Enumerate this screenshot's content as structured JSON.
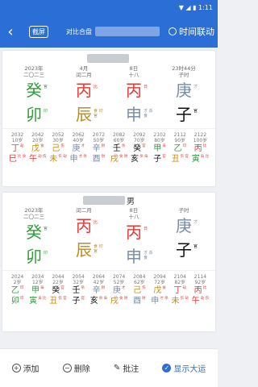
{
  "status": {
    "time": "",
    "icons": "▼ ◢ ▮ 1:11"
  },
  "header": {
    "back_icon": "chevron-left-icon",
    "cut_label": "截屏",
    "title": "对比合盘",
    "link_label": "时间联动"
  },
  "cards": [
    {
      "gender": "",
      "pillars": [
        {
          "top1": "2023年",
          "top2": "二〇二三",
          "gan": "癸",
          "gan_tag": "官",
          "gan_color": "green",
          "zhi": "卯",
          "zhi_tag": "印",
          "zhi_color": "green"
        },
        {
          "top1": "4月",
          "top2": "闰二月",
          "gan": "丙",
          "gan_tag": "比",
          "gan_color": "red",
          "zhi": "辰",
          "zhi_tag": "食 印 官",
          "zhi_color": "gold"
        },
        {
          "top1": "8日",
          "top2": "十八",
          "gan": "丙",
          "gan_tag": "日",
          "gan_color": "red",
          "zhi": "申",
          "zhi_tag": "才 杀 食",
          "zhi_color": "gray"
        },
        {
          "top1": "23时44分",
          "top2": "子时",
          "gan": "庚",
          "gan_tag": "才",
          "gan_color": "gray",
          "zhi": "子",
          "zhi_tag": "官",
          "zhi_color": "black"
        }
      ],
      "luck": [
        {
          "yr": "2032",
          "age": "10岁",
          "g": "丁",
          "gc": "red",
          "gt": "劫",
          "z": "巳",
          "zc": "red",
          "zt": "比 食"
        },
        {
          "yr": "2042",
          "age": "20岁",
          "g": "戊",
          "gc": "gold",
          "gt": "食",
          "z": "午",
          "zc": "red",
          "zt": "劫 伤"
        },
        {
          "yr": "2052",
          "age": "30岁",
          "g": "己",
          "gc": "gold",
          "gt": "伤",
          "z": "未",
          "zc": "gold",
          "zt": "伤 劫"
        },
        {
          "yr": "2062",
          "age": "40岁",
          "g": "庚",
          "gc": "gray",
          "gt": "才",
          "z": "申",
          "zc": "gray",
          "zt": "才 杀"
        },
        {
          "yr": "2072",
          "age": "50岁",
          "g": "辛",
          "gc": "gray",
          "gt": "财",
          "z": "酉",
          "zc": "gray",
          "zt": "财"
        },
        {
          "yr": "2082",
          "age": "60岁",
          "g": "壬",
          "gc": "black",
          "gt": "杀",
          "z": "戌",
          "zc": "gold",
          "zt": "食 财"
        },
        {
          "yr": "2092",
          "age": "70岁",
          "g": "癸",
          "gc": "black",
          "gt": "官",
          "z": "亥",
          "zc": "black",
          "zt": "杀 枭"
        },
        {
          "yr": "2102",
          "age": "80岁",
          "g": "甲",
          "gc": "green",
          "gt": "枭",
          "z": "子",
          "zc": "black",
          "zt": "官"
        },
        {
          "yr": "2112",
          "age": "90岁",
          "g": "乙",
          "gc": "green",
          "gt": "印",
          "z": "丑",
          "zc": "gold",
          "zt": "伤 官"
        },
        {
          "yr": "2122",
          "age": "100岁",
          "g": "丙",
          "gc": "red",
          "gt": "比",
          "z": "寅",
          "zc": "green",
          "zt": "枭 比"
        }
      ]
    },
    {
      "gender": "男",
      "pillars": [
        {
          "top1": "2023年",
          "top2": "二〇二三",
          "gan": "癸",
          "gan_tag": "官",
          "gan_color": "green",
          "zhi": "卯",
          "zhi_tag": "印",
          "zhi_color": "green"
        },
        {
          "top1": "",
          "top2": "闰二月",
          "gan": "丙",
          "gan_tag": "比",
          "gan_color": "red",
          "zhi": "辰",
          "zhi_tag": "食 印 官",
          "zhi_color": "gold"
        },
        {
          "top1": "8日",
          "top2": "十八",
          "gan": "丙",
          "gan_tag": "日",
          "gan_color": "red",
          "zhi": "申",
          "zhi_tag": "才 杀 食",
          "zhi_color": "gray"
        },
        {
          "top1": "",
          "top2": "子时",
          "gan": "庚",
          "gan_tag": "才",
          "gan_color": "gray",
          "zhi": "子",
          "zhi_tag": "官",
          "zhi_color": "black"
        }
      ],
      "luck": [
        {
          "yr": "2024",
          "age": "2岁",
          "g": "乙",
          "gc": "green",
          "gt": "印",
          "z": "卯",
          "zc": "green",
          "zt": "印"
        },
        {
          "yr": "2034",
          "age": "12岁",
          "g": "甲",
          "gc": "green",
          "gt": "枭",
          "z": "寅",
          "zc": "green",
          "zt": "枭 比"
        },
        {
          "yr": "2044",
          "age": "22岁",
          "g": "癸",
          "gc": "black",
          "gt": "官",
          "z": "丑",
          "zc": "gold",
          "zt": "伤 官"
        },
        {
          "yr": "2054",
          "age": "32岁",
          "g": "壬",
          "gc": "black",
          "gt": "杀",
          "z": "子",
          "zc": "black",
          "zt": "官"
        },
        {
          "yr": "2064",
          "age": "42岁",
          "g": "辛",
          "gc": "gray",
          "gt": "财",
          "z": "亥",
          "zc": "black",
          "zt": "杀 枭"
        },
        {
          "yr": "2074",
          "age": "52岁",
          "g": "庚",
          "gc": "gray",
          "gt": "才",
          "z": "戌",
          "zc": "gold",
          "zt": "食 财"
        },
        {
          "yr": "2084",
          "age": "62岁",
          "g": "己",
          "gc": "gold",
          "gt": "伤",
          "z": "酉",
          "zc": "gray",
          "zt": "财"
        },
        {
          "yr": "2094",
          "age": "72岁",
          "g": "戊",
          "gc": "gold",
          "gt": "食",
          "z": "申",
          "zc": "gray",
          "zt": "才 杀"
        },
        {
          "yr": "2104",
          "age": "82岁",
          "g": "丁",
          "gc": "red",
          "gt": "劫",
          "z": "未",
          "zc": "gold",
          "zt": "伤 劫"
        },
        {
          "yr": "2114",
          "age": "92岁",
          "g": "丙",
          "gc": "red",
          "gt": "比",
          "z": "午",
          "zc": "red",
          "zt": "劫 伤"
        }
      ]
    }
  ],
  "bottom": {
    "add": "添加",
    "del": "删除",
    "note": "批注",
    "show": "显示大运"
  }
}
